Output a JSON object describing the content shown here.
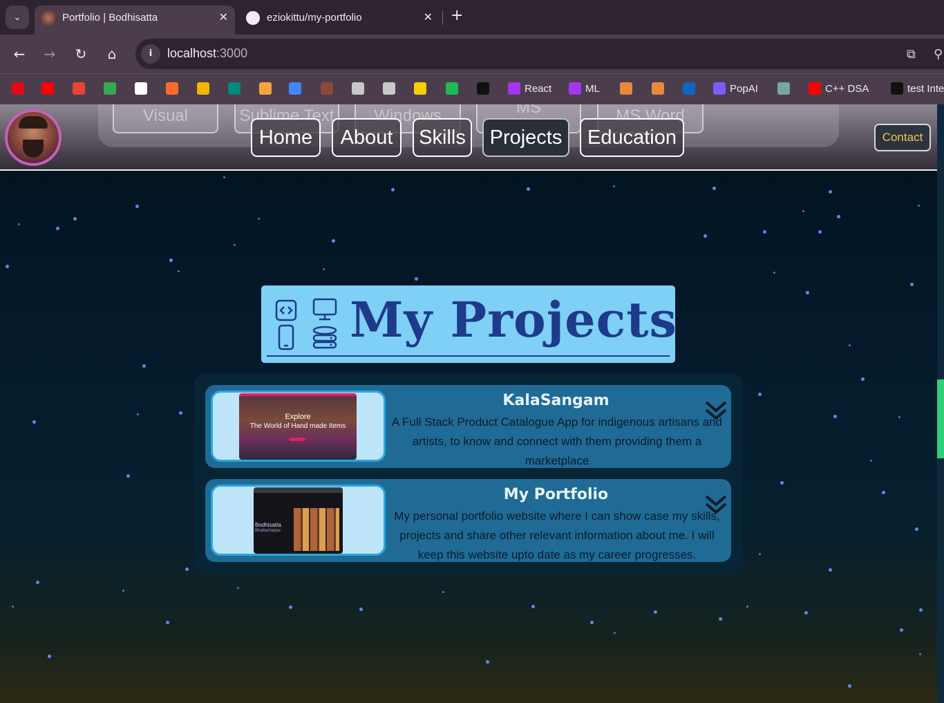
{
  "browser": {
    "tabs": [
      {
        "title": "Portfolio | Bodhisatta",
        "active": true,
        "icon": "profile-favicon"
      },
      {
        "title": "eziokittu/my-portfolio",
        "active": false,
        "icon": "github-icon"
      }
    ],
    "address": {
      "host": "localhost",
      "port": ":3000"
    },
    "bookmarks": [
      {
        "label": "",
        "icon": "netflix-icon",
        "color": "#e50914"
      },
      {
        "label": "",
        "icon": "youtube-icon",
        "color": "#ff0000"
      },
      {
        "label": "",
        "icon": "gmail-icon",
        "color": "#ea4335"
      },
      {
        "label": "",
        "icon": "drive-icon",
        "color": "#34a853"
      },
      {
        "label": "",
        "icon": "github-icon",
        "color": "#ffffff"
      },
      {
        "label": "",
        "icon": "x-icon",
        "color": "#ff6a2b"
      },
      {
        "label": "",
        "icon": "classroom-icon",
        "color": "#f4b400"
      },
      {
        "label": "",
        "icon": "meet-icon",
        "color": "#00897b"
      },
      {
        "label": "",
        "icon": "layers-icon",
        "color": "#f4a340"
      },
      {
        "label": "",
        "icon": "analytics-icon",
        "color": "#4285f4"
      },
      {
        "label": "",
        "icon": "profile-icon",
        "color": "#8a4a3a"
      },
      {
        "label": "",
        "icon": "unity-icon",
        "color": "#c8c8c8"
      },
      {
        "label": "",
        "icon": "unity-icon",
        "color": "#c8c8c8"
      },
      {
        "label": "",
        "icon": "pen-icon",
        "color": "#f5d000"
      },
      {
        "label": "",
        "icon": "spotify-icon",
        "color": "#1db954"
      },
      {
        "label": "",
        "icon": "hackerrank-icon",
        "color": "#111111"
      },
      {
        "label": "React",
        "icon": "udemy-icon",
        "color": "#a435f0"
      },
      {
        "label": "ML",
        "icon": "udemy-icon",
        "color": "#a435f0"
      },
      {
        "label": "",
        "icon": "codechef-icon",
        "color": "#e8883a"
      },
      {
        "label": "",
        "icon": "codechef-icon",
        "color": "#e8883a"
      },
      {
        "label": "",
        "icon": "linkedin-icon",
        "color": "#0a66c2"
      },
      {
        "label": "PopAI",
        "icon": "popai-icon",
        "color": "#7b5cff"
      },
      {
        "label": "",
        "icon": "chatgpt-icon",
        "color": "#74aa9c"
      },
      {
        "label": "C++ DSA",
        "icon": "youtube-icon",
        "color": "#ff0000"
      },
      {
        "label": "test Inte",
        "icon": "hackerrank-icon",
        "color": "#111111"
      }
    ]
  },
  "header": {
    "skills_ghost": [
      "Visual Studios",
      "Sublime Text",
      "Windows",
      "MS Powerpoint",
      "MS Word"
    ],
    "nav": [
      {
        "label": "Home",
        "active": false
      },
      {
        "label": "About",
        "active": false
      },
      {
        "label": "Skills",
        "active": false
      },
      {
        "label": "Projects",
        "active": true
      },
      {
        "label": "Education",
        "active": false
      }
    ],
    "contact": "Contact"
  },
  "projects": {
    "heading": "My Projects",
    "items": [
      {
        "title": "KalaSangam",
        "description": "A Full Stack Product Catalogue App for indigenous artisans and artists, to know and connect with them providing them a marketplace",
        "thumb_caption_1": "Explore",
        "thumb_caption_2": "The World of Hand made Items"
      },
      {
        "title": "My Portfolio",
        "description": "My personal portfolio website where I can show case my skills, projects and share other relevant information about me. I will keep this website upto date as my career progresses.",
        "thumb_caption_1": "Bodhisatta",
        "thumb_caption_2": "Bhattacharjee"
      }
    ]
  },
  "colors": {
    "accent_nav_border": "#ffffff",
    "contact_text": "#f3c650",
    "heading_bg": "#7fd0f7",
    "heading_text": "#1e3a8a",
    "card_bg": "#1f6b95",
    "scroll_thumb": "#2fd07a"
  }
}
